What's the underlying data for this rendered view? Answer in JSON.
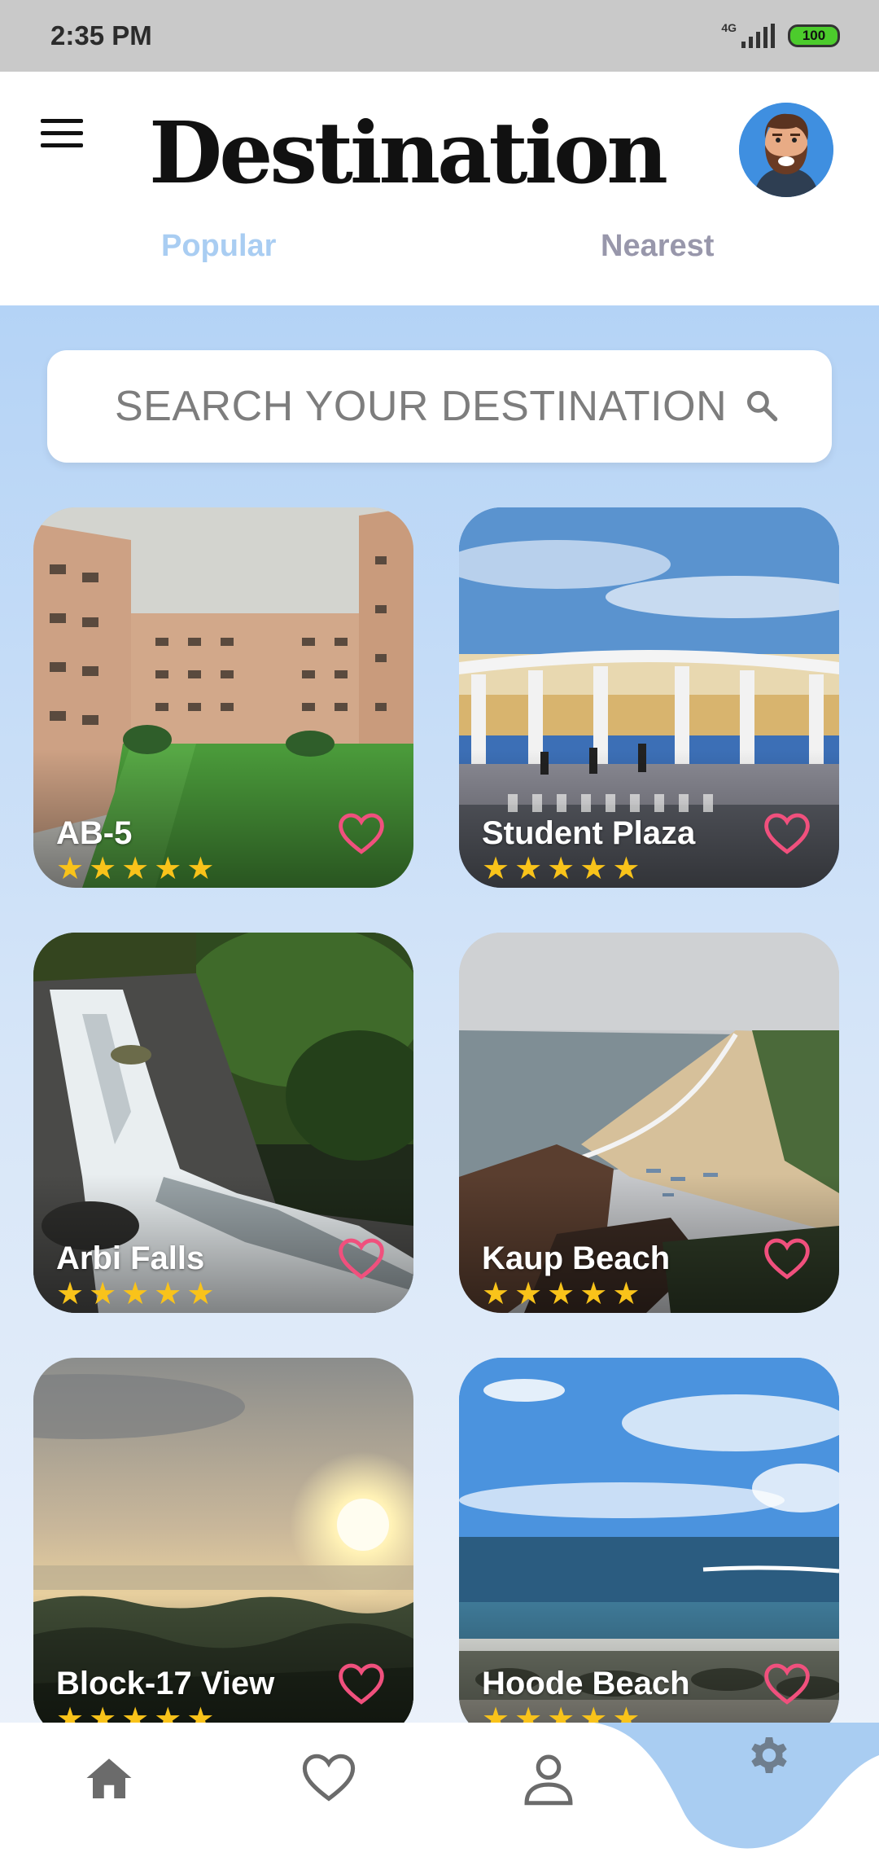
{
  "status_bar": {
    "time": "2:35 PM",
    "network": "4G",
    "battery": "100"
  },
  "header": {
    "title": "Destination",
    "tabs": [
      {
        "label": "Popular",
        "active": true
      },
      {
        "label": "Nearest",
        "active": false
      }
    ]
  },
  "search": {
    "placeholder": "SEARCH YOUR DESTINATION"
  },
  "cards": [
    {
      "name": "AB-5",
      "rating": 5
    },
    {
      "name": "Student Plaza",
      "rating": 5
    },
    {
      "name": "Arbi Falls",
      "rating": 5
    },
    {
      "name": "Kaup Beach",
      "rating": 5
    },
    {
      "name": "Block-17 View",
      "rating": 5
    },
    {
      "name": "Hoode Beach",
      "rating": 5
    }
  ],
  "colors": {
    "tab_active": "#a9cdf2",
    "tab_inactive": "#9897ab",
    "star": "#f9c31a",
    "heart": "#f0507d",
    "nav_active_bg": "#a9cdf2"
  },
  "bottom_nav": [
    {
      "icon": "home-icon"
    },
    {
      "icon": "heart-icon"
    },
    {
      "icon": "person-icon"
    },
    {
      "icon": "gear-icon",
      "active": true
    }
  ]
}
